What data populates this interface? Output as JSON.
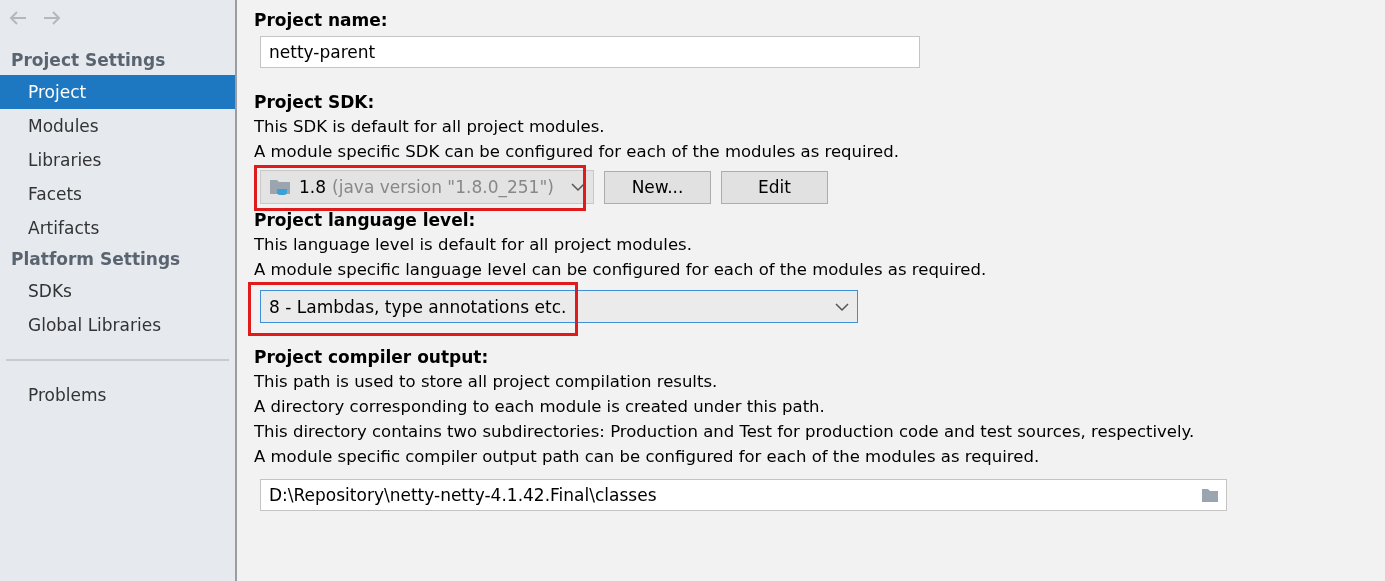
{
  "sidebar": {
    "nav_back": {
      "disabled": true
    },
    "nav_forward": {
      "disabled": true
    },
    "groups": [
      {
        "title": "Project Settings",
        "items": [
          {
            "label": "Project",
            "selected": true
          },
          {
            "label": "Modules",
            "selected": false
          },
          {
            "label": "Libraries",
            "selected": false
          },
          {
            "label": "Facets",
            "selected": false
          },
          {
            "label": "Artifacts",
            "selected": false
          }
        ]
      },
      {
        "title": "Platform Settings",
        "items": [
          {
            "label": "SDKs",
            "selected": false
          },
          {
            "label": "Global Libraries",
            "selected": false
          }
        ]
      }
    ],
    "bottom_items": [
      {
        "label": "Problems",
        "selected": false
      }
    ]
  },
  "project_name": {
    "label": "Project name:",
    "value": "netty-parent"
  },
  "project_sdk": {
    "label": "Project SDK:",
    "description": [
      "This SDK is default for all project modules.",
      "A module specific SDK can be configured for each of the modules as required."
    ],
    "combo": {
      "version": "1.8",
      "detail": "(java version \"1.8.0_251\")",
      "disabled": true,
      "highlighted": true
    },
    "buttons": [
      "New...",
      "Edit"
    ]
  },
  "language_level": {
    "label": "Project language level:",
    "description": [
      "This language level is default for all project modules.",
      "A module specific language level can be configured for each of the modules as required."
    ],
    "combo": {
      "value": "8 - Lambdas, type annotations etc.",
      "focused": true,
      "highlighted": true
    }
  },
  "compiler_output": {
    "label": "Project compiler output:",
    "description": [
      "This path is used to store all project compilation results.",
      "A directory corresponding to each module is created under this path.",
      "This directory contains two subdirectories: Production and Test for production code and test sources, respectively.",
      "A module specific compiler output path can be configured for each of the modules as required."
    ],
    "value": "D:\\Repository\\netty-netty-4.1.42.Final\\classes"
  }
}
